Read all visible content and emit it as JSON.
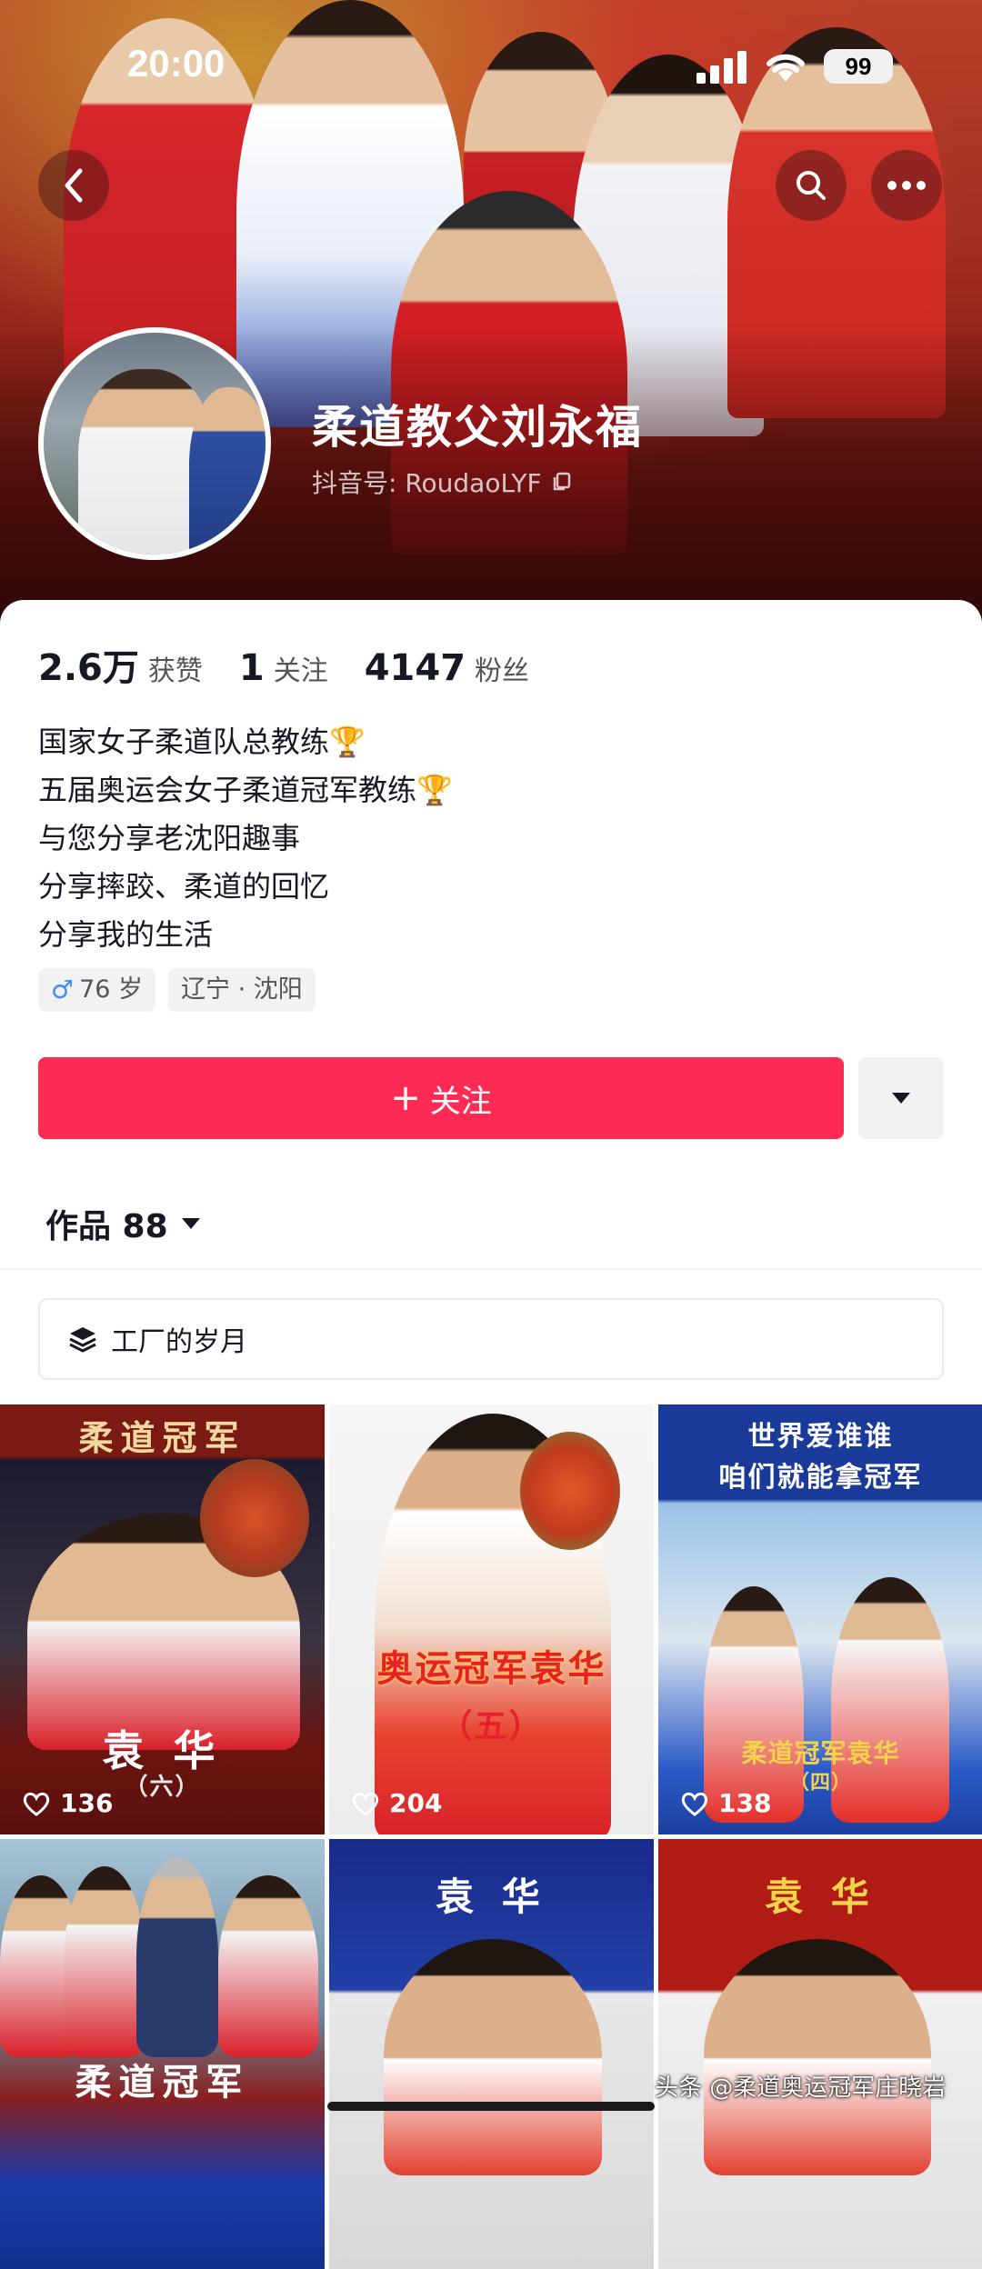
{
  "status_bar": {
    "time": "20:00",
    "battery": "99"
  },
  "profile": {
    "name": "柔道教父刘永福",
    "douyin_id": "抖音号: RoudaoLYF"
  },
  "stats": [
    {
      "value": "2.6万",
      "label": "获赞"
    },
    {
      "value": "1",
      "label": "关注"
    },
    {
      "value": "4147",
      "label": "粉丝"
    }
  ],
  "bio": [
    "国家女子柔道队总教练🏆",
    "五届奥运会女子柔道冠军教练🏆",
    "与您分享老沈阳趣事",
    "分享摔跤、柔道的回忆",
    "分享我的生活"
  ],
  "tags": {
    "age": "76 岁",
    "location": "辽宁 · 沈阳"
  },
  "actions": {
    "follow": "关注"
  },
  "works": {
    "label": "作品 88"
  },
  "collection": {
    "label": "工厂的岁月"
  },
  "videos": [
    {
      "top_text": "柔道冠军",
      "caption": "袁 华",
      "sub": "（六）",
      "likes": "136"
    },
    {
      "top_text": "",
      "caption": "奥运冠军袁华",
      "sub": "（五）",
      "likes": "204"
    },
    {
      "top_text": "世界爱谁谁",
      "top_text2": "咱们就能拿冠军",
      "caption": "柔道冠军袁华",
      "sub": "（四）",
      "likes": "138"
    },
    {
      "top_text": "",
      "caption": "柔道冠军",
      "sub": "",
      "likes": ""
    },
    {
      "top_text": "袁 华",
      "caption": "",
      "sub": "",
      "likes": ""
    },
    {
      "top_text": "袁 华",
      "caption": "",
      "sub": "",
      "likes": ""
    }
  ],
  "watermark": "头条 @柔道奥运冠军庄晓岩",
  "colors": {
    "accent": "#fe2c55",
    "banner": "#9e2a1f"
  }
}
